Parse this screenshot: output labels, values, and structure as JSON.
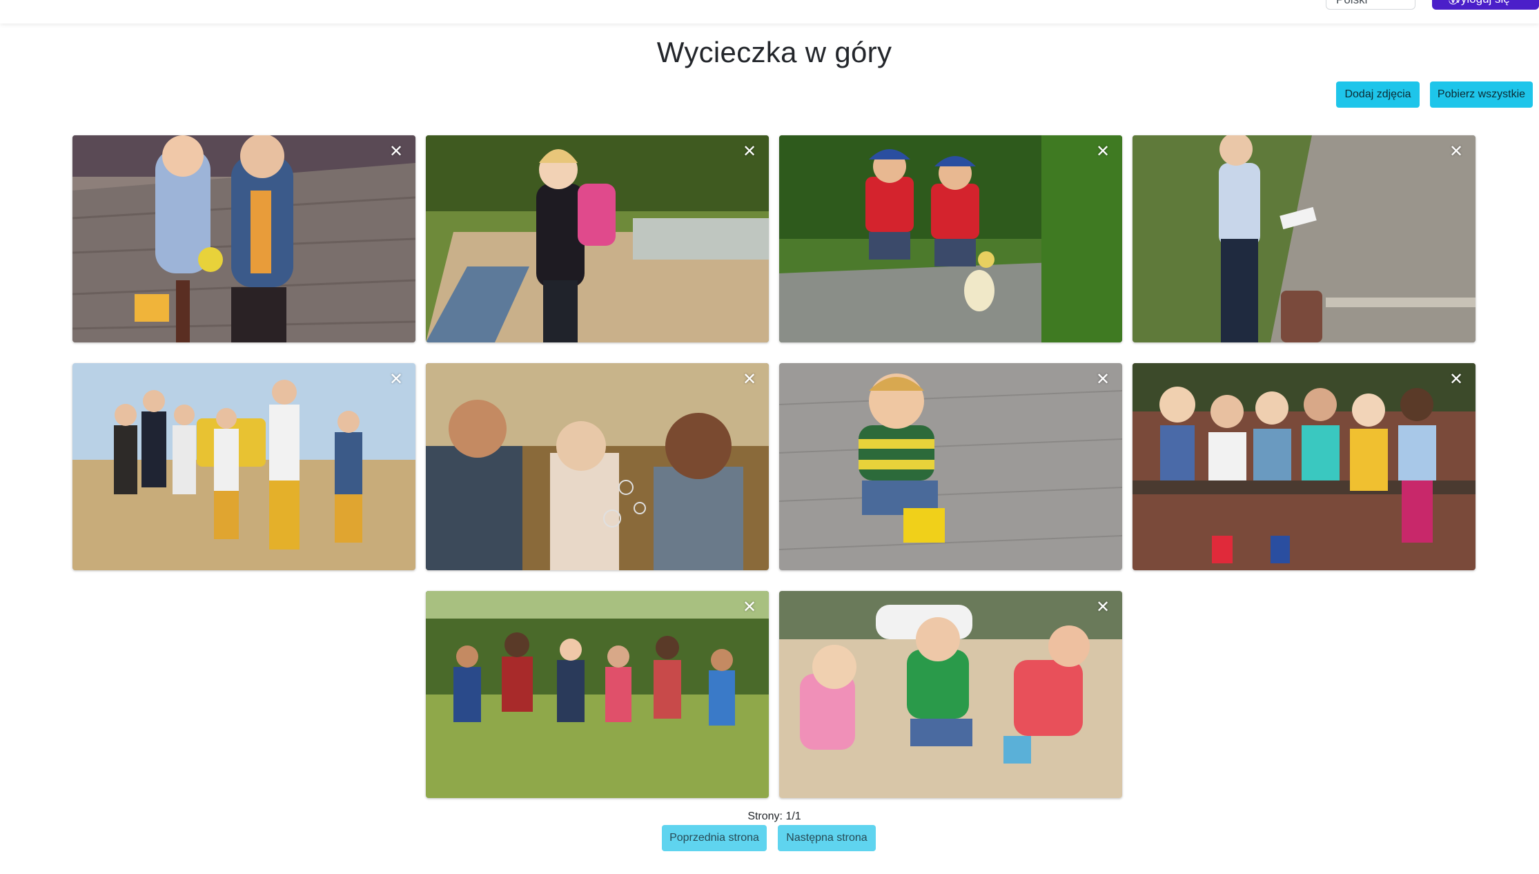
{
  "header": {
    "language_selected": "Polski",
    "logout_label": "Wyloguj się"
  },
  "album": {
    "title": "Wycieczka w góry",
    "add_photos_label": "Dodaj zdjęcia",
    "download_all_label": "Pobierz wszystkie"
  },
  "photos": [
    {
      "subject": "two boys on wooden bridge",
      "close_icon": "close-icon"
    },
    {
      "subject": "girl with pink backpack",
      "close_icon": "close-icon"
    },
    {
      "subject": "two boys with duckling in stream",
      "close_icon": "close-icon"
    },
    {
      "subject": "boy with suitcase reading",
      "close_icon": "close-icon"
    },
    {
      "subject": "children walking in field",
      "close_icon": "close-icon"
    },
    {
      "subject": "children with bubbles",
      "close_icon": "close-icon"
    },
    {
      "subject": "boy in yellow boots on pavement",
      "close_icon": "close-icon"
    },
    {
      "subject": "children sitting on bench",
      "close_icon": "close-icon"
    },
    {
      "subject": "children running in park",
      "close_icon": "close-icon"
    },
    {
      "subject": "children playing in sandbox",
      "close_icon": "close-icon"
    }
  ],
  "pagination": {
    "label": "Strony: 1/1",
    "prev_label": "Poprzednia strona",
    "next_label": "Następna strona"
  },
  "colors": {
    "accent": "#1ec5ea",
    "pager_button": "#5fd4ef",
    "logout_button": "#4b1fc9"
  }
}
